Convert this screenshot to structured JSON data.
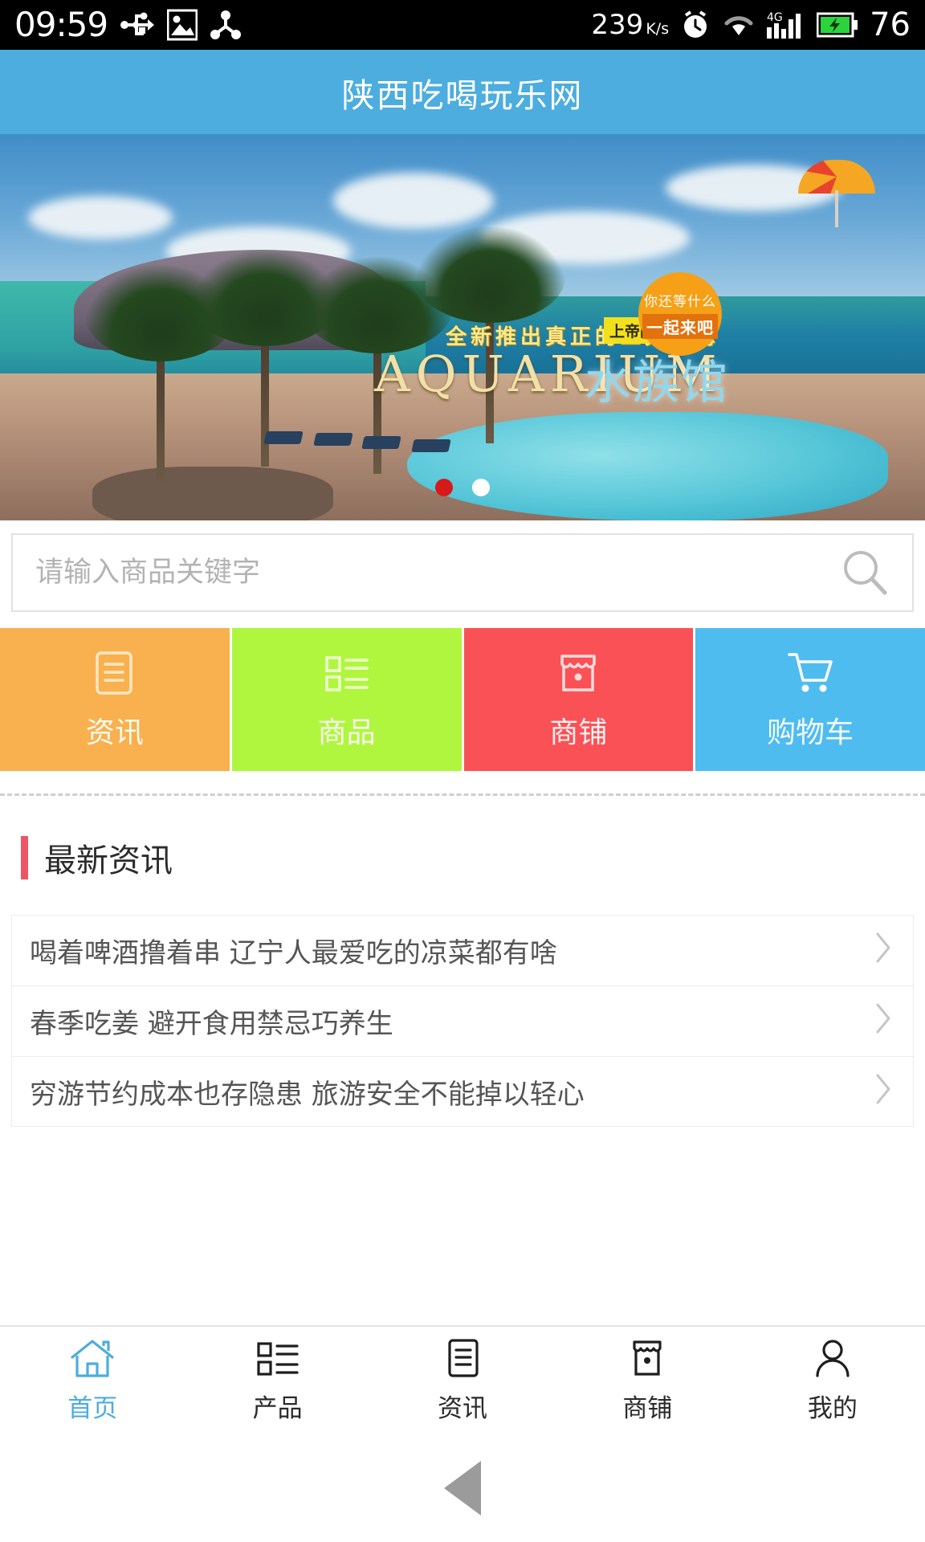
{
  "statusbar": {
    "time": "09:59",
    "icons_left": [
      "usb-icon",
      "image-icon",
      "share-node-icon"
    ],
    "network_speed": "239",
    "network_speed_unit": "K/s",
    "icons_right": [
      "alarm-clock-icon",
      "wifi-icon",
      "signal-4g-icon",
      "battery-charging-icon"
    ],
    "battery_percent": "76"
  },
  "header": {
    "title": "陕西吃喝玩乐网",
    "bg_color": "#4cadde"
  },
  "banner": {
    "tagline": "全新推出真正的三天出海",
    "title_en": "AQUARIUM",
    "title_cn": "水族馆",
    "tag": "上帝的水族馆",
    "badge_line1": "你还等什么",
    "badge_line2": "一起来吧",
    "dots": [
      {
        "name": "dot-1",
        "state": "active"
      },
      {
        "name": "dot-2",
        "state": "idle"
      }
    ]
  },
  "search": {
    "placeholder": "请输入商品关键字",
    "value": "",
    "icon": "search-icon"
  },
  "tiles": [
    {
      "label": "资讯",
      "icon": "document-icon",
      "color": "#f8b14e"
    },
    {
      "label": "商品",
      "icon": "list-icon",
      "color": "#b0f63e"
    },
    {
      "label": "商铺",
      "icon": "store-icon",
      "color": "#fa5156"
    },
    {
      "label": "购物车",
      "icon": "cart-icon",
      "color": "#4fbcf0"
    }
  ],
  "section": {
    "title": "最新资讯",
    "accent_color": "#ed5565"
  },
  "news": [
    {
      "title": "喝着啤酒撸着串 辽宁人最爱吃的凉菜都有啥",
      "chevron": "chevron-right-icon"
    },
    {
      "title": "春季吃姜 避开食用禁忌巧养生",
      "chevron": "chevron-right-icon"
    },
    {
      "title": "穷游节约成本也存隐患 旅游安全不能掉以轻心",
      "chevron": "chevron-right-icon"
    }
  ],
  "tabbar": {
    "active_color": "#4cadde",
    "items": [
      {
        "label": "首页",
        "icon": "home-icon",
        "active": true
      },
      {
        "label": "产品",
        "icon": "list-icon",
        "active": false
      },
      {
        "label": "资讯",
        "icon": "document-icon",
        "active": false
      },
      {
        "label": "商铺",
        "icon": "store-icon",
        "active": false
      },
      {
        "label": "我的",
        "icon": "person-icon",
        "active": false
      }
    ]
  },
  "sysnav": {
    "back": "back-triangle-icon"
  }
}
